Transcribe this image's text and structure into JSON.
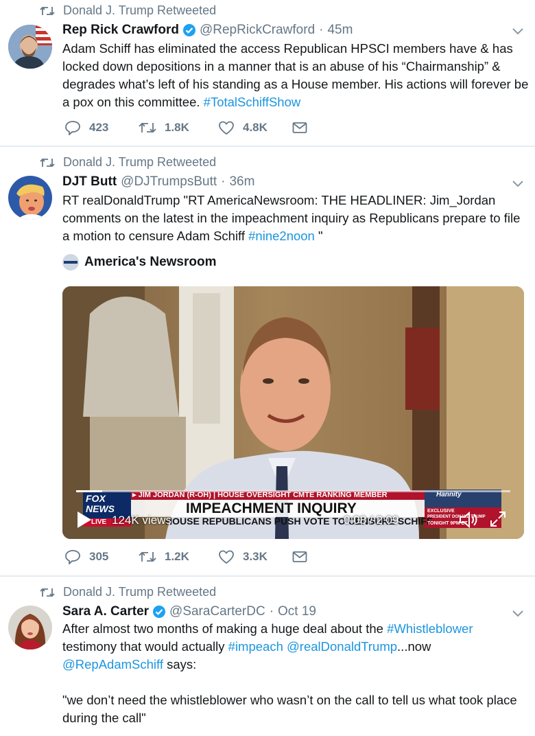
{
  "tweets": [
    {
      "retweeted_by": "Donald J. Trump Retweeted",
      "name": "Rep Rick Crawford",
      "handle": "@RepRickCrawford",
      "sep": "·",
      "time": "45m",
      "text_parts": [
        "Adam Schiff has eliminated the access Republican HPSCI members have & has locked down depositions in a manner that is an abuse of his “Chairmanship” & degrades what’s left of his standing as a House member. His actions will forever be a pox on this committee. ",
        "#TotalSchiffShow"
      ],
      "replies": "423",
      "retweets": "1.8K",
      "likes": "4.8K"
    },
    {
      "retweeted_by": "Donald J. Trump Retweeted",
      "name": "DJT Butt",
      "handle": "@DJTrumpsButt",
      "sep": "·",
      "time": "36m",
      "text_parts": [
        "RT realDonaldTrump \"RT AmericaNewsroom: THE HEADLINER: Jim_Jordan comments on the latest in the impeachment inquiry as Republicans prepare to file a motion to censure Adam Schiff ",
        "#nine2noon",
        " \""
      ],
      "card_source": "America's Newsroom",
      "video": {
        "banner_top": "▸ JIM JORDAN (R-OH) | HOUSE OVERSIGHT CMTE RANKING MEMBER",
        "banner_main": "IMPEACHMENT INQUIRY",
        "banner_sub": "HOUSE REPUBLICANS PUSH VOTE TO CENSURE SCHIFF",
        "channel_logo": "FOX NEWS",
        "live": "LIVE",
        "views": "124K views",
        "time": "0:08 / 2:09",
        "promo_brand": "Hannity",
        "promo_line1": "EXCLUSIVE",
        "promo_line2": "PRESIDENT DONALD TRUMP",
        "promo_line3": "TONIGHT 9PM ET",
        "progress": 0.06
      },
      "replies": "305",
      "retweets": "1.2K",
      "likes": "3.3K"
    },
    {
      "retweeted_by": "Donald J. Trump Retweeted",
      "name": "Sara A. Carter",
      "handle": "@SaraCarterDC",
      "sep": "·",
      "time": "Oct 19",
      "text_line1_a": "After almost two months of making a huge deal about the ",
      "text_line1_b": "#Whistleblower",
      "text_line2_a": "testimony that would actually ",
      "text_line2_b": "#impeach",
      "text_line2_c": " ",
      "text_line2_d": "@realDonaldTrump",
      "text_line2_e": "...now",
      "text_line3_a": "@RepAdamSchiff",
      "text_line3_b": " says:",
      "quote": "\"we don’t need the whistleblower who wasn’t on the call to tell us what took place during the call\""
    }
  ],
  "colors": {
    "link": "#1b95e0",
    "muted": "#657786",
    "verified": "#1da1f2"
  },
  "icons": [
    "retweet-icon",
    "verified-icon",
    "chevron-down-icon",
    "reply-icon",
    "like-icon",
    "message-icon",
    "play-icon",
    "volume-icon",
    "expand-icon"
  ]
}
